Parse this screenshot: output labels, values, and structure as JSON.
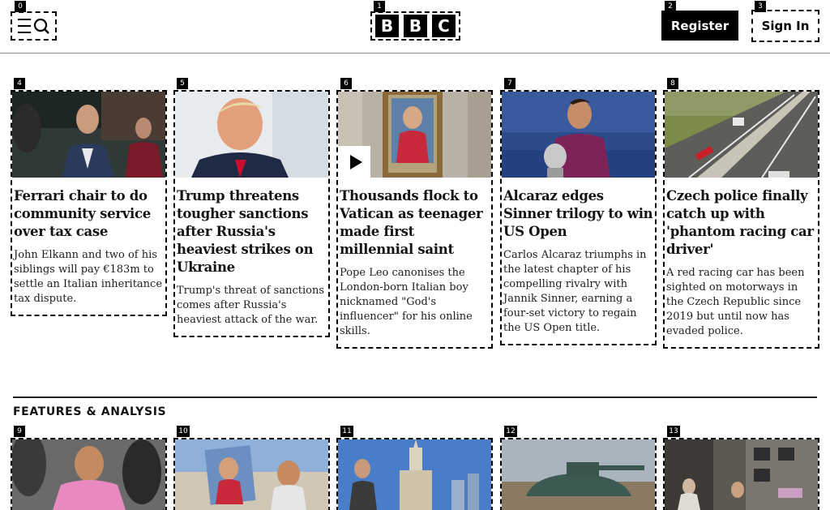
{
  "header": {
    "logo_letters": [
      "B",
      "B",
      "C"
    ],
    "register_label": "Register",
    "signin_label": "Sign In",
    "menu_icon": "menu-search-icon"
  },
  "badges": [
    "0",
    "1",
    "2",
    "3",
    "4",
    "5",
    "6",
    "7",
    "8",
    "9",
    "10",
    "11",
    "12",
    "13"
  ],
  "stories": [
    {
      "headline": "Ferrari chair to do community service over tax case",
      "summary": "John Elkann and two of his siblings will pay €183m to settle an Italian inheritance tax dispute."
    },
    {
      "headline": "Trump threatens tougher sanctions after Russia's heaviest strikes on Ukraine",
      "summary": "Trump's threat of sanctions comes after Russia's heaviest attack of the war."
    },
    {
      "headline": "Thousands flock to Vatican as teenager made first millennial saint",
      "summary": "Pope Leo canonises the London-born Italian boy nicknamed \"God's influencer\" for his online skills.",
      "has_video": true
    },
    {
      "headline": "Alcaraz edges Sinner trilogy to win US Open",
      "summary": "Carlos Alcaraz triumphs in the latest chapter of his compelling rivalry with Jannik Sinner, earning a four-set victory to regain the US Open title."
    },
    {
      "headline": "Czech police finally catch up with 'phantom racing car driver'",
      "summary": "A red racing car has been sighted on motorways in the Czech Republic since 2019 but until now has evaded police."
    }
  ],
  "features": {
    "title": "FEATURES & ANALYSIS"
  }
}
